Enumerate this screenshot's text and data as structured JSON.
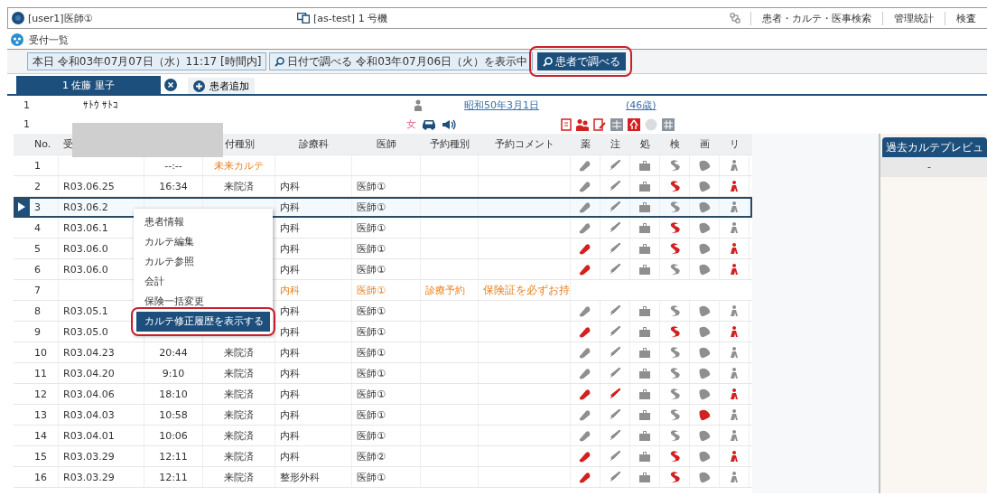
{
  "top_bar": {
    "user": "[user1]医師①",
    "terminal": "[as-test] 1 号機",
    "menu": [
      "患者・カルテ・医事検索",
      "管理統計",
      "検査"
    ]
  },
  "screen_title": "受付一覧",
  "toolbar": [
    {
      "label": "本日 令和03年07月07日（水）11:17 [時間内]",
      "kind": "plain"
    },
    {
      "label": "日付で調べる 令和03年07月06日（火）を表示中",
      "kind": "search"
    },
    {
      "label": "患者で調べる",
      "kind": "primary",
      "highlighted": true
    }
  ],
  "patient_tabs": [
    {
      "label": "1 佐藤 里子",
      "selected": true
    }
  ],
  "add_patient": "患者追加",
  "patient": {
    "no": "1",
    "kana": "ｻﾄｳ ｻﾄｺ",
    "birthday": "昭和50年3月1日",
    "age": "(46歳)",
    "no_2": "1",
    "sex": "女"
  },
  "table": {
    "columns": [
      "",
      "No.",
      "受",
      "",
      "付種別",
      "診療科",
      "医師",
      "予約種別",
      "予約コメント",
      "薬",
      "注",
      "処",
      "検",
      "画",
      "リ"
    ],
    "rows": [
      {
        "no": "1",
        "time": "--:--",
        "type": "未来カルテ",
        "kind": "future",
        "selected": false,
        "icons": [
          false,
          false,
          false,
          false,
          false,
          false
        ]
      },
      {
        "no": "2",
        "date": "R03.06.25",
        "time": "16:34",
        "type": "来院済",
        "dept": "内科",
        "doctor": "医師①",
        "kind": "visit",
        "selected": false,
        "icons": [
          false,
          false,
          false,
          true,
          false,
          true
        ]
      },
      {
        "no": "3",
        "date": "R03.06.2",
        "dept": "内科",
        "doctor": "医師①",
        "kind": "visit",
        "selected": true,
        "icons": [
          false,
          false,
          false,
          false,
          false,
          false
        ]
      },
      {
        "no": "4",
        "date": "R03.06.1",
        "dept": "内科",
        "doctor": "医師①",
        "kind": "visit",
        "selected": false,
        "icons": [
          false,
          false,
          false,
          true,
          false,
          false
        ]
      },
      {
        "no": "5",
        "date": "R03.06.0",
        "dept": "内科",
        "doctor": "医師①",
        "kind": "visit",
        "selected": false,
        "icons": [
          true,
          false,
          false,
          true,
          false,
          true
        ]
      },
      {
        "no": "6",
        "date": "R03.06.0",
        "dept": "内科",
        "doctor": "医師①",
        "kind": "visit",
        "selected": false,
        "icons": [
          true,
          false,
          false,
          false,
          false,
          true
        ]
      },
      {
        "no": "7",
        "dept": "内科",
        "doctor": "医師①",
        "res_type": "診療予約",
        "comment": "保険証を必ずお持",
        "kind": "reservation",
        "selected": false
      },
      {
        "no": "8",
        "date": "R03.05.1",
        "dept": "内科",
        "doctor": "医師①",
        "kind": "visit",
        "selected": false,
        "icons": [
          false,
          false,
          false,
          false,
          false,
          false
        ]
      },
      {
        "no": "9",
        "date": "R03.05.0",
        "dept": "内科",
        "doctor": "医師①",
        "kind": "visit",
        "selected": false,
        "icons": [
          true,
          false,
          false,
          true,
          false,
          true
        ]
      },
      {
        "no": "10",
        "date": "R03.04.23",
        "time": "20:44",
        "type": "来院済",
        "dept": "内科",
        "doctor": "医師①",
        "kind": "visit",
        "selected": false,
        "icons": [
          false,
          false,
          false,
          false,
          false,
          false
        ]
      },
      {
        "no": "11",
        "date": "R03.04.20",
        "time": "9:10",
        "type": "来院済",
        "dept": "内科",
        "doctor": "医師①",
        "kind": "visit",
        "selected": false,
        "icons": [
          false,
          false,
          false,
          false,
          false,
          false
        ]
      },
      {
        "no": "12",
        "date": "R03.04.06",
        "time": "18:10",
        "type": "来院済",
        "dept": "内科",
        "doctor": "医師①",
        "kind": "visit",
        "selected": false,
        "icons": [
          true,
          true,
          false,
          false,
          false,
          true
        ]
      },
      {
        "no": "13",
        "date": "R03.04.03",
        "time": "10:58",
        "type": "来院済",
        "dept": "内科",
        "doctor": "医師①",
        "kind": "visit",
        "selected": false,
        "icons": [
          false,
          false,
          false,
          false,
          true,
          false
        ]
      },
      {
        "no": "14",
        "date": "R03.04.01",
        "time": "10:06",
        "type": "来院済",
        "dept": "内科",
        "doctor": "医師①",
        "kind": "visit",
        "selected": false,
        "icons": [
          false,
          false,
          false,
          false,
          false,
          false
        ]
      },
      {
        "no": "15",
        "date": "R03.03.29",
        "time": "12:11",
        "type": "来院済",
        "dept": "内科",
        "doctor": "医師②",
        "kind": "visit",
        "selected": false,
        "icons": [
          true,
          false,
          false,
          true,
          false,
          true
        ]
      },
      {
        "no": "16",
        "date": "R03.03.29",
        "time": "12:11",
        "type": "来院済",
        "dept": "整形外科",
        "doctor": "医師①",
        "kind": "visit",
        "selected": false,
        "icons": [
          true,
          false,
          false,
          true,
          false,
          false
        ]
      }
    ]
  },
  "context_menu": [
    {
      "label": "患者情報",
      "selected": false
    },
    {
      "label": "カルテ編集",
      "selected": false
    },
    {
      "label": "カルテ参照",
      "selected": false
    },
    {
      "label": "会計",
      "selected": false
    },
    {
      "label": "保険一括変更",
      "selected": false
    },
    {
      "label": "カルテ修正履歴を表示する",
      "selected": true
    }
  ],
  "preview_panel": {
    "title": "過去カルテプレビュ",
    "selector": "-"
  }
}
